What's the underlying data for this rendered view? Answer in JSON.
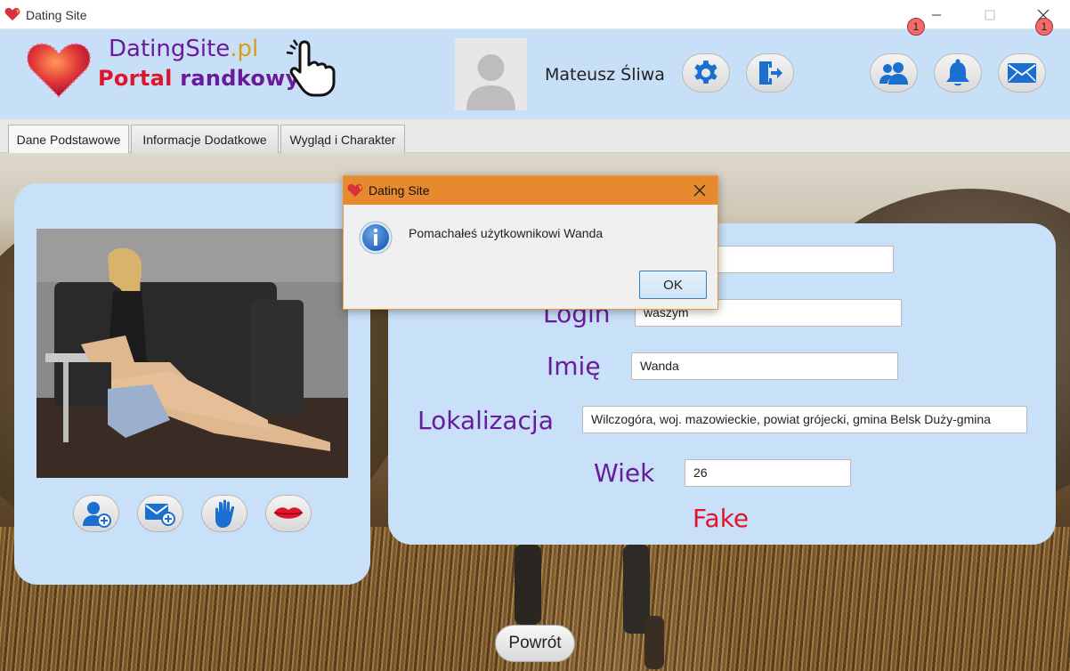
{
  "window": {
    "title": "Dating Site",
    "icons": {
      "app": "heart-icon",
      "minimize": "minimize-icon",
      "maximize": "maximize-icon",
      "close": "close-icon"
    }
  },
  "header": {
    "logo_line1_main": "DatingSite",
    "logo_line1_suffix": ".pl",
    "logo_line2_part1": "Portal ",
    "logo_line2_part2": "randkowy",
    "user_name": "Mateusz Śliwa",
    "buttons": {
      "settings": "gear-icon",
      "logout": "logout-icon",
      "friends": "users-icon",
      "notifications": "bell-icon",
      "messages": "envelope-icon"
    },
    "friends_badge": "1",
    "messages_badge": "1",
    "colors": {
      "header_bg": "#c7e0f8",
      "icon_blue": "#1a6fd1",
      "accent_red": "#e0142b",
      "accent_purple": "#6a1b9a"
    }
  },
  "tabs": [
    {
      "label": "Dane Podstawowe",
      "active": true
    },
    {
      "label": "Informacje Dodatkowe",
      "active": false
    },
    {
      "label": "Wygląd i Charakter",
      "active": false
    }
  ],
  "profile": {
    "actions": [
      "add-friend-icon",
      "send-message-icon",
      "wave-hand-icon",
      "kiss-lips-icon"
    ],
    "fields": {
      "login_label": "Login",
      "login_value": "waszym",
      "first_field_value": "",
      "name_label": "Imię",
      "name_value": "Wanda",
      "location_label": "Lokalizacja",
      "location_value": "Wilczogóra, woj. mazowieckie, powiat grójecki, gmina Belsk Duży-gmina",
      "age_label": "Wiek",
      "age_value": "26"
    },
    "fake_label": "Fake"
  },
  "back_button": "Powrót",
  "dialog": {
    "title": "Dating Site",
    "message": "Pomachałeś użytkownikowi Wanda",
    "ok_label": "OK",
    "icon": "info-icon",
    "titlebar_color": "#e6892f"
  }
}
